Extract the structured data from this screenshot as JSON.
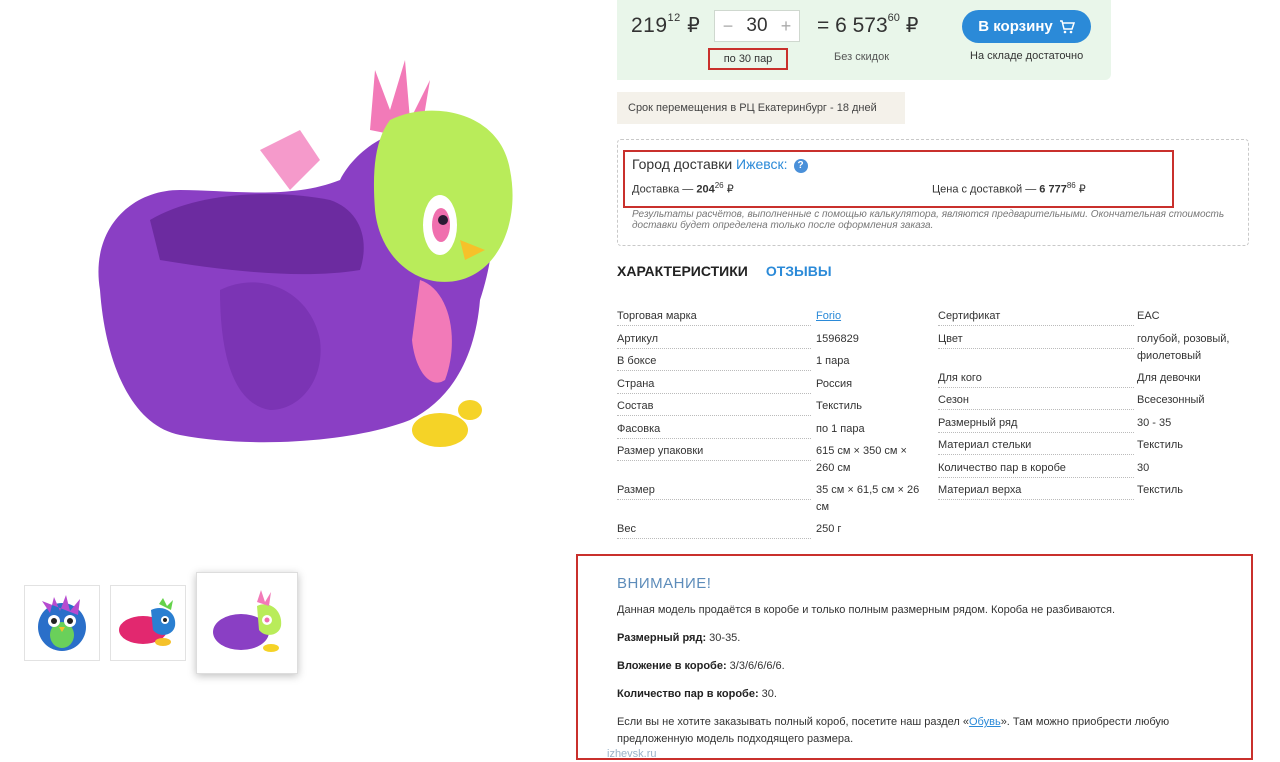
{
  "purchase": {
    "price_main": "219",
    "price_cents": "12",
    "currency": "₽",
    "qty_minus": "−",
    "qty_value": "30",
    "qty_plus": "+",
    "qty_note": "по 30 пар",
    "total_prefix": "= 6 573",
    "total_cents": "60",
    "discount": "Без скидок",
    "cart_label": "В корзину",
    "stock": "На складе достаточно"
  },
  "transfer": "Срок перемещения в РЦ Екатеринбург - 18 дней",
  "delivery": {
    "city_label": "Город доставки",
    "city": "Ижевск:",
    "help": "?",
    "cost_label": "Доставка —",
    "cost_main": "204",
    "cost_cents": "26",
    "total_label": "Цена с доставкой —",
    "total_main": "6 777",
    "total_cents": "86",
    "note": "Результаты расчётов, выполненные с помощью калькулятора, являются предварительными. Окончательная стоимость доставки будет определена только после оформления заказа."
  },
  "tabs": {
    "chars": "ХАРАКТЕРИСТИКИ",
    "reviews": "ОТЗЫВЫ"
  },
  "specs_left": [
    {
      "name": "Торговая марка",
      "value": "Forio",
      "link": true
    },
    {
      "name": "Артикул",
      "value": "1596829"
    },
    {
      "name": "В боксе",
      "value": "1 пара"
    },
    {
      "name": "Страна",
      "value": "Россия"
    },
    {
      "name": "Состав",
      "value": "Текстиль"
    },
    {
      "name": "Фасовка",
      "value": "по 1 пара"
    },
    {
      "name": "Размер упаковки",
      "value": "615 см × 350 см ×",
      "value2": "260 см"
    },
    {
      "name": "Размер",
      "value": "35 см × 61,5 см × 26",
      "value2": "см"
    },
    {
      "name": "Вес",
      "value": "250 г"
    }
  ],
  "specs_right": [
    {
      "name": "Сертификат",
      "value": "EAC"
    },
    {
      "name": "Цвет",
      "value": "голубой, розовый,",
      "value2": "фиолетовый"
    },
    {
      "name": "Для кого",
      "value": "Для девочки"
    },
    {
      "name": "Сезон",
      "value": "Всесезонный"
    },
    {
      "name": "Размерный ряд",
      "value": "30 - 35"
    },
    {
      "name": "Материал стельки",
      "value": "Текстиль"
    },
    {
      "name": "Количество пар в коробе",
      "value": "30"
    },
    {
      "name": "Материал верха",
      "value": "Текстиль"
    }
  ],
  "attention": {
    "title": "ВНИМАНИЕ!",
    "line1": "Данная модель продаётся в коробе и только полным размерным рядом. Короба не разбиваются.",
    "size_label": "Размерный ряд:",
    "size_value": " 30-35.",
    "nest_label": "Вложение в коробе:",
    "nest_value": " 3/3/6/6/6/6.",
    "count_label": "Количество пар в коробе:",
    "count_value": " 30.",
    "line5a": "Если вы не хотите заказывать полный короб, посетите наш раздел «",
    "line5_link": "Обувь",
    "line5b": "». Там можно приобрести любую",
    "line6": "предложенную модель подходящего размера."
  },
  "watermark": "izhevsk.ru",
  "colors": {
    "accent": "#2b8ad8",
    "highlight": "#c9302c",
    "panel": "#e9f6ea"
  }
}
